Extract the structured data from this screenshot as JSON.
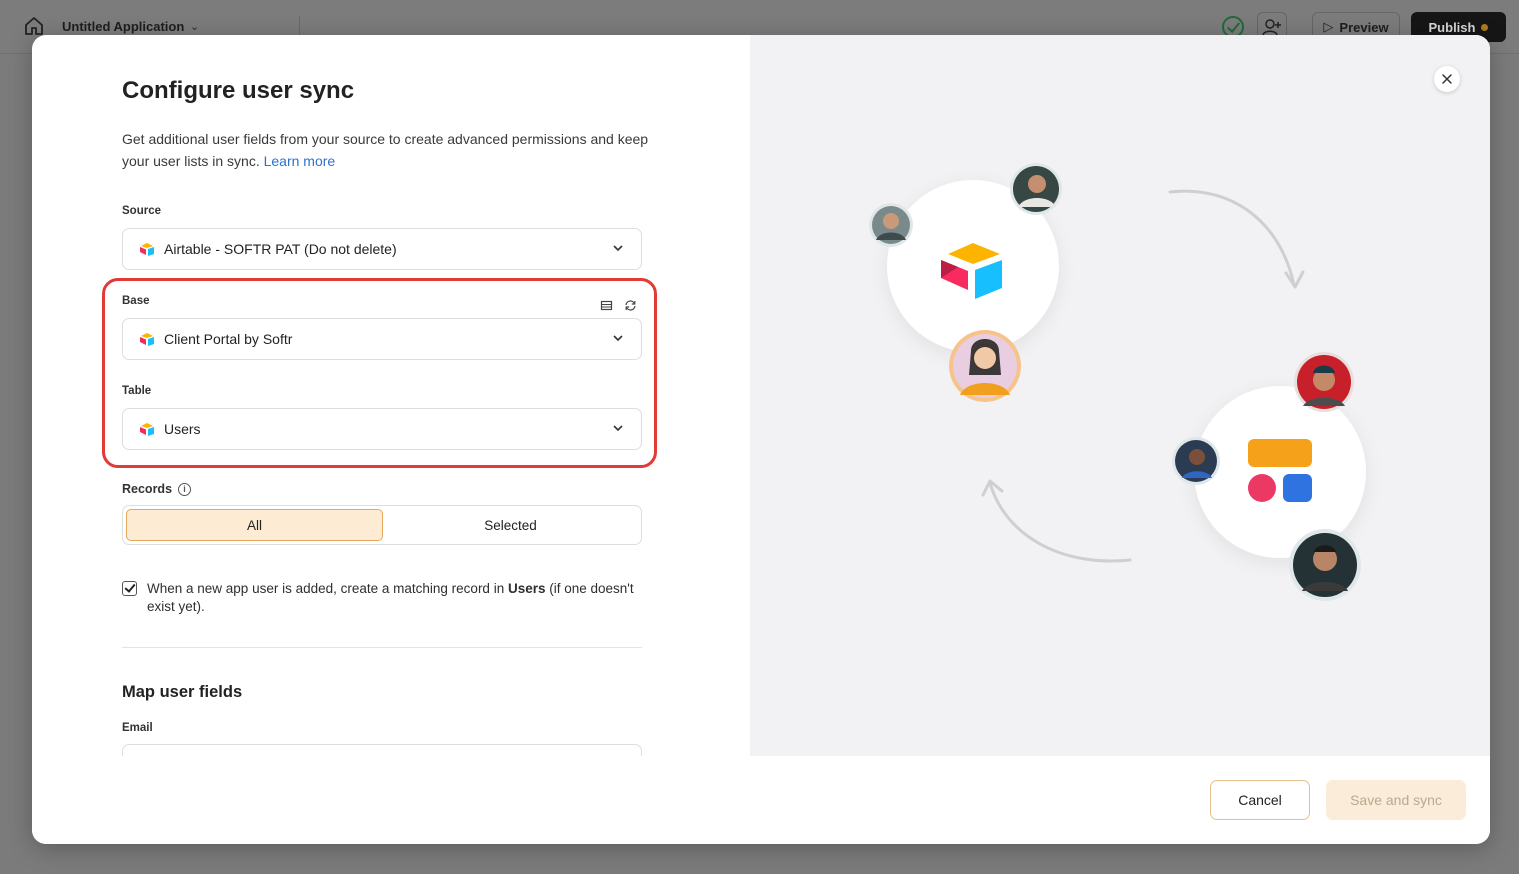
{
  "app": {
    "title": "Untitled Application",
    "preview_label": "Preview",
    "publish_label": "Publish"
  },
  "modal": {
    "title": "Configure user sync",
    "description": "Get additional user fields from your source to create advanced permissions and keep your user lists in sync.",
    "learn_more": "Learn more",
    "source": {
      "label": "Source",
      "value": "Airtable - SOFTR PAT (Do not delete)"
    },
    "base": {
      "label": "Base",
      "value": "Client Portal by Softr"
    },
    "table": {
      "label": "Table",
      "value": "Users"
    },
    "records": {
      "label": "Records",
      "options": [
        "All",
        "Selected"
      ],
      "selected": "All"
    },
    "create_record": {
      "checked": true,
      "text_before": "When a new app user is added, create a matching record in ",
      "table_name": "Users",
      "text_after": " (if one doesn't exist yet)."
    },
    "map_section": {
      "title": "Map user fields",
      "email_label": "Email"
    },
    "buttons": {
      "cancel": "Cancel",
      "save": "Save and sync"
    }
  },
  "colors": {
    "highlight": "#e23a36",
    "accent_link": "#2e6fd1",
    "active_segment": "#fdebd3",
    "save_disabled_bg": "#faecd8"
  }
}
